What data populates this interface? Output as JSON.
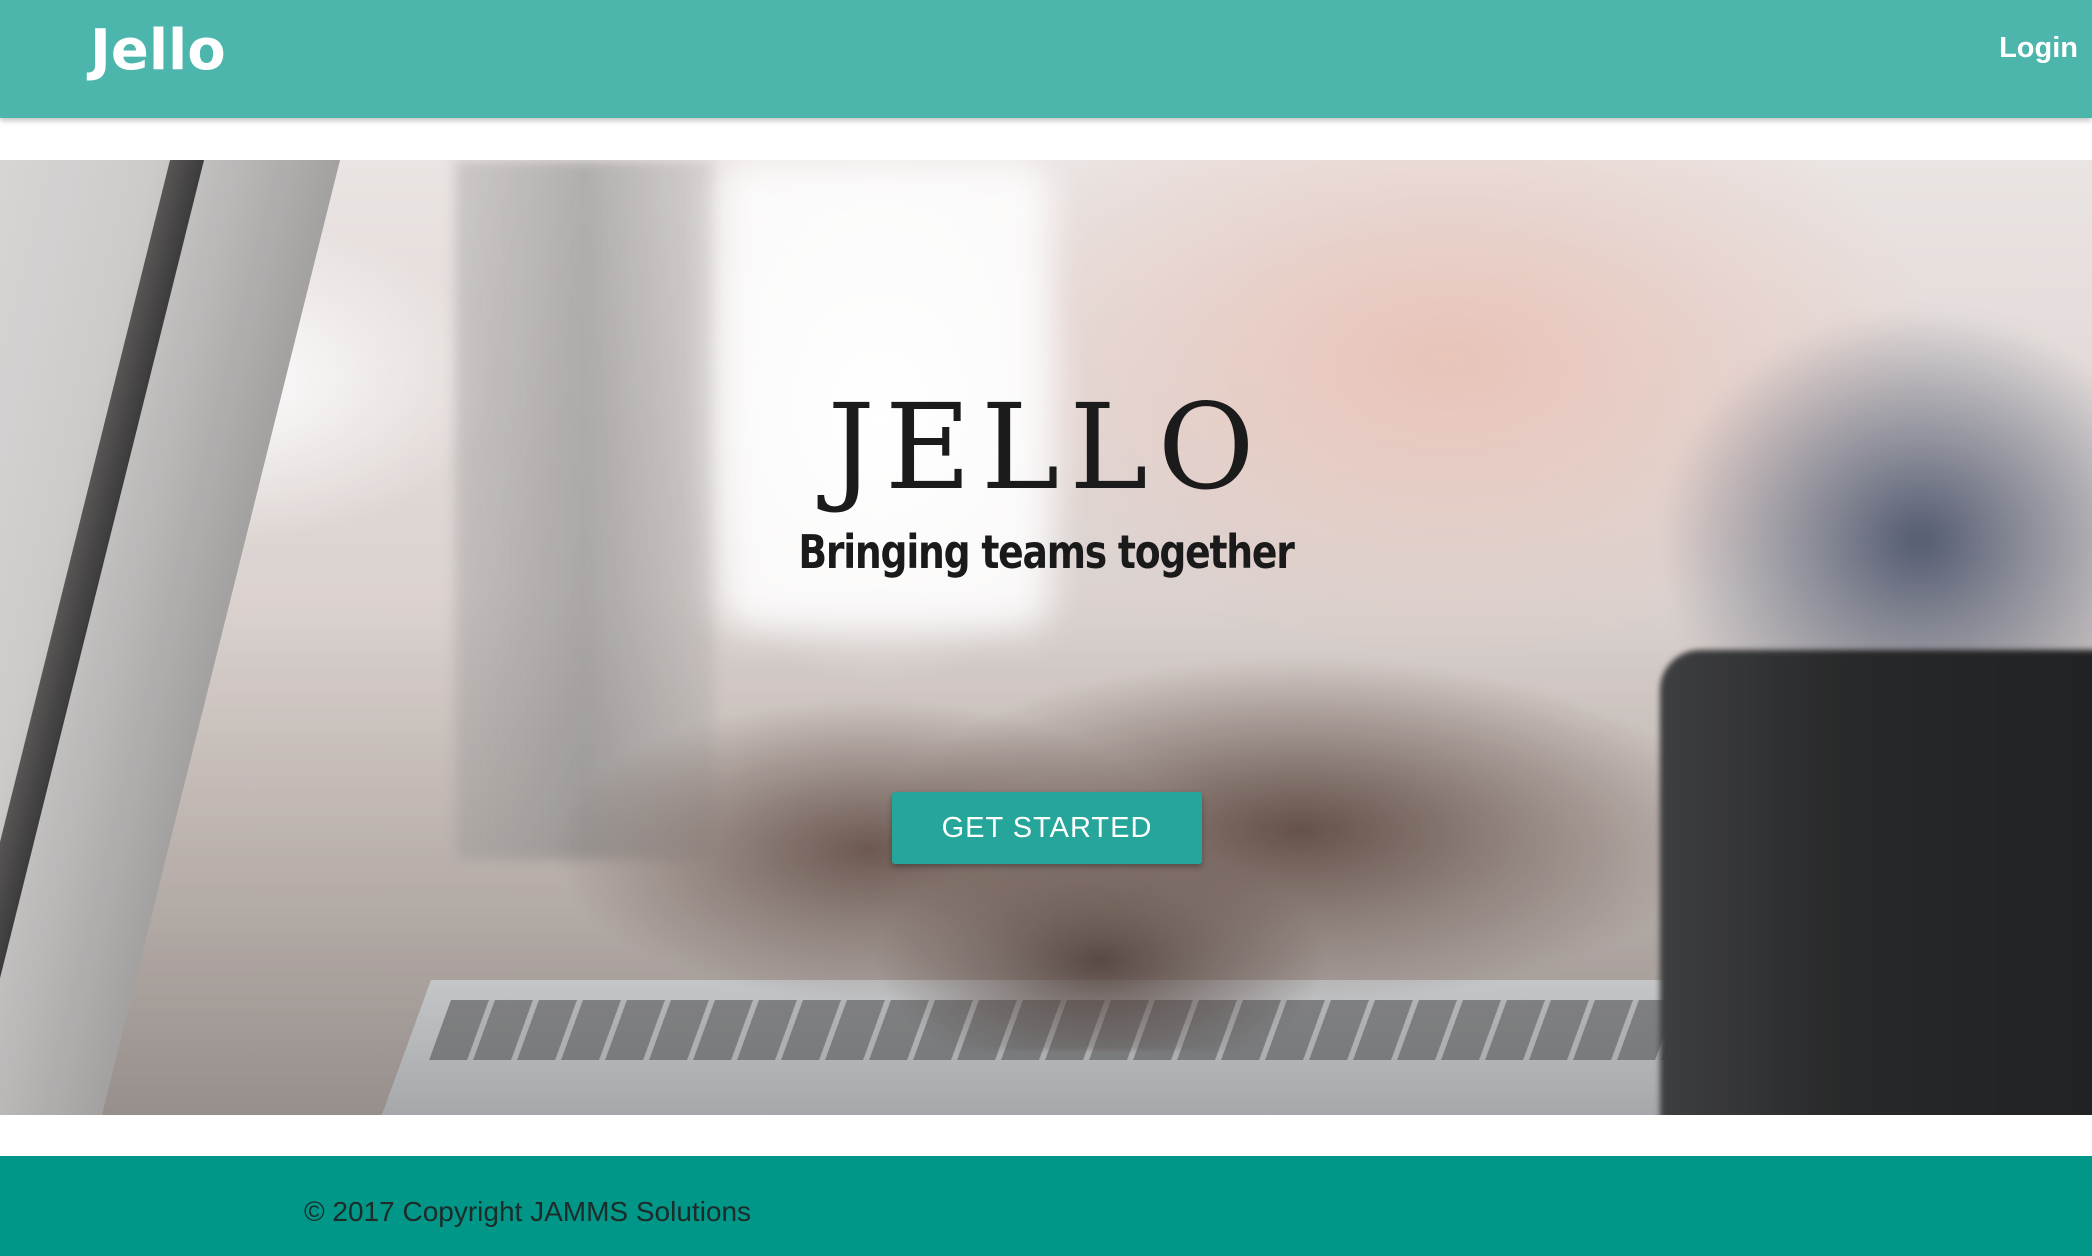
{
  "navbar": {
    "brand": "Jello",
    "login_label": "Login"
  },
  "hero": {
    "title": "JELLO",
    "subtitle": "Bringing teams together",
    "cta_label": "GET STARTED"
  },
  "footer": {
    "copyright": "© 2017 Copyright JAMMS Solutions"
  },
  "colors": {
    "navbar": "#4db6ac",
    "button": "#26a69a",
    "footer": "#009688"
  }
}
